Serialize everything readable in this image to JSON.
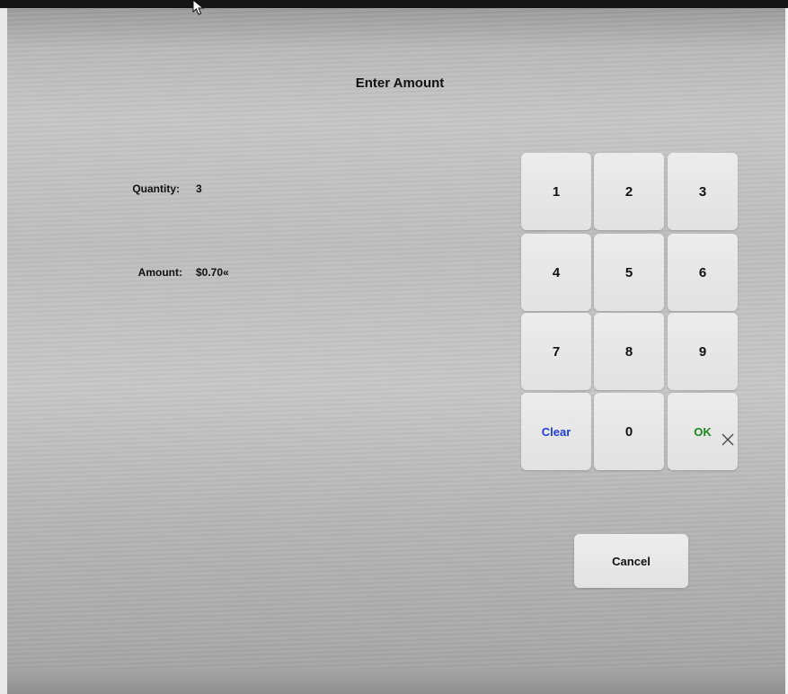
{
  "dialog": {
    "title": "Enter Amount",
    "quantity_label": "Quantity:",
    "quantity_value": "3",
    "amount_label": "Amount:",
    "amount_value": "$0.70«"
  },
  "keypad": {
    "keys": [
      "1",
      "2",
      "3",
      "4",
      "5",
      "6",
      "7",
      "8",
      "9",
      "Clear",
      "0",
      "OK"
    ]
  },
  "cancel_label": "Cancel",
  "icons": {
    "pointer": "mouse-pointer-icon",
    "cross": "close-x-cursor-icon"
  },
  "colors": {
    "clear_text": "#1f3cd6",
    "ok_text": "#1e8a1e",
    "key_bg": "#e6e6e6"
  }
}
